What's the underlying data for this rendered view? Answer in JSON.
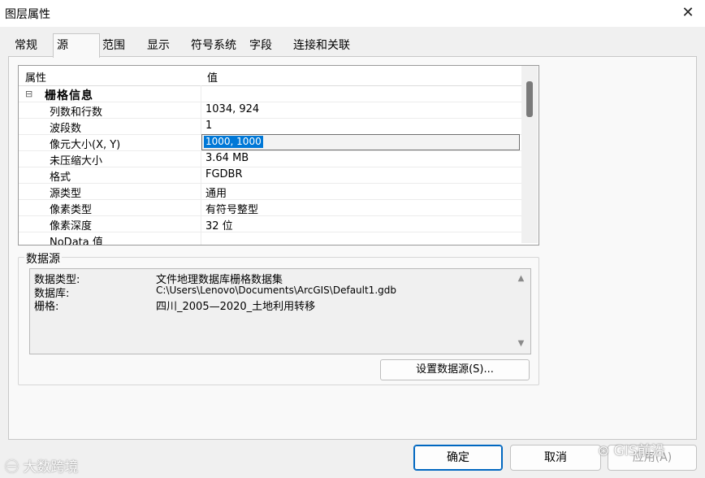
{
  "window": {
    "title": "图层属性",
    "close_glyph": "✕"
  },
  "tabs": [
    {
      "label": "常规"
    },
    {
      "label": "源"
    },
    {
      "label": "范围"
    },
    {
      "label": "显示"
    },
    {
      "label": "符号系统"
    },
    {
      "label": "字段"
    },
    {
      "label": "连接和关联"
    }
  ],
  "active_tab": "源",
  "grid": {
    "header": {
      "key": "属性",
      "value": "值"
    },
    "category": {
      "label": "栅格信息",
      "toggle": "⊟"
    },
    "rows": [
      {
        "key": "列数和行数",
        "value": "1034, 924"
      },
      {
        "key": "波段数",
        "value": "1"
      },
      {
        "key": "像元大小(X, Y)",
        "value": "1000, 1000"
      },
      {
        "key": "未压缩大小",
        "value": "3.64 MB"
      },
      {
        "key": "格式",
        "value": "FGDBR"
      },
      {
        "key": "源类型",
        "value": "通用"
      },
      {
        "key": "像素类型",
        "value": "有符号整型"
      },
      {
        "key": "像素深度",
        "value": "32 位"
      },
      {
        "key": "NoData 值",
        "value": ""
      }
    ]
  },
  "data_source": {
    "label": "数据源",
    "items": [
      {
        "key": "数据类型:",
        "value": "文件地理数据库栅格数据集"
      },
      {
        "key": "数据库:",
        "value": "C:\\Users\\Lenovo\\Documents\\ArcGIS\\Default1.gdb"
      },
      {
        "key": "栅格:",
        "value": "四川_2005—2020_土地利用转移"
      }
    ],
    "scroll_up": "▲",
    "scroll_down": "▼",
    "set_button": "设置数据源(S)..."
  },
  "footer": {
    "ok": "确定",
    "cancel": "取消",
    "apply": "应用(A)"
  },
  "watermarks": {
    "left": "㊀ 大数跨境",
    "right": "⊛ GIS前沿"
  },
  "colors": {
    "selection": "#0078d7",
    "ok_border": "#0067c0"
  }
}
